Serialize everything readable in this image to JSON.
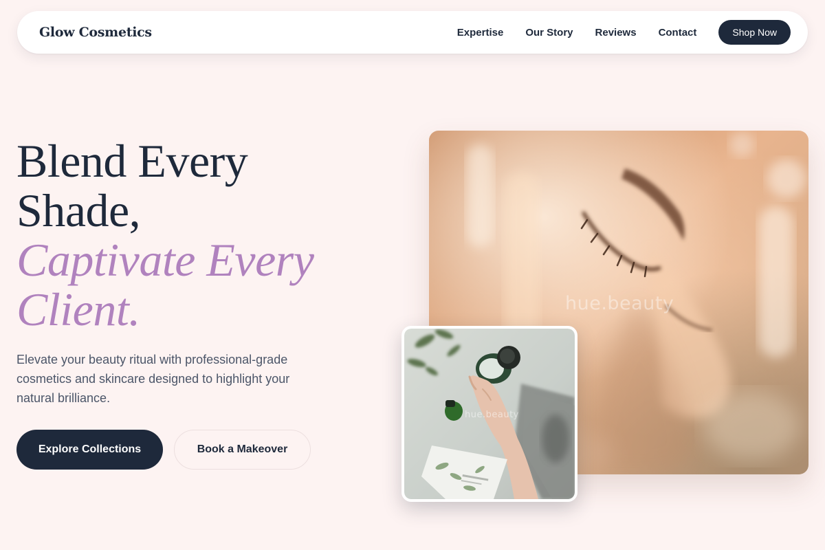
{
  "brand": {
    "name": "Glow Cosmetics"
  },
  "nav": {
    "links": [
      "Expertise",
      "Our Story",
      "Reviews",
      "Contact"
    ],
    "cta_label": "Shop Now"
  },
  "hero": {
    "headline_line1": "Blend Every",
    "headline_line2": "Shade,",
    "headline_accent_line1": "Captivate Every",
    "headline_accent_line2": "Client.",
    "subtext": "Elevate your beauty ritual with professional-grade cosmetics and skincare designed to highlight your natural brilliance.",
    "primary_cta": "Explore Collections",
    "secondary_cta": "Book a Makeover"
  },
  "images": {
    "main_watermark": "hue.beauty",
    "inset_watermark": "hue.beauty"
  },
  "colors": {
    "background": "#fdf3f2",
    "navy": "#1e293b",
    "accent_purple": "#b082be",
    "body_text": "#4b5568"
  }
}
